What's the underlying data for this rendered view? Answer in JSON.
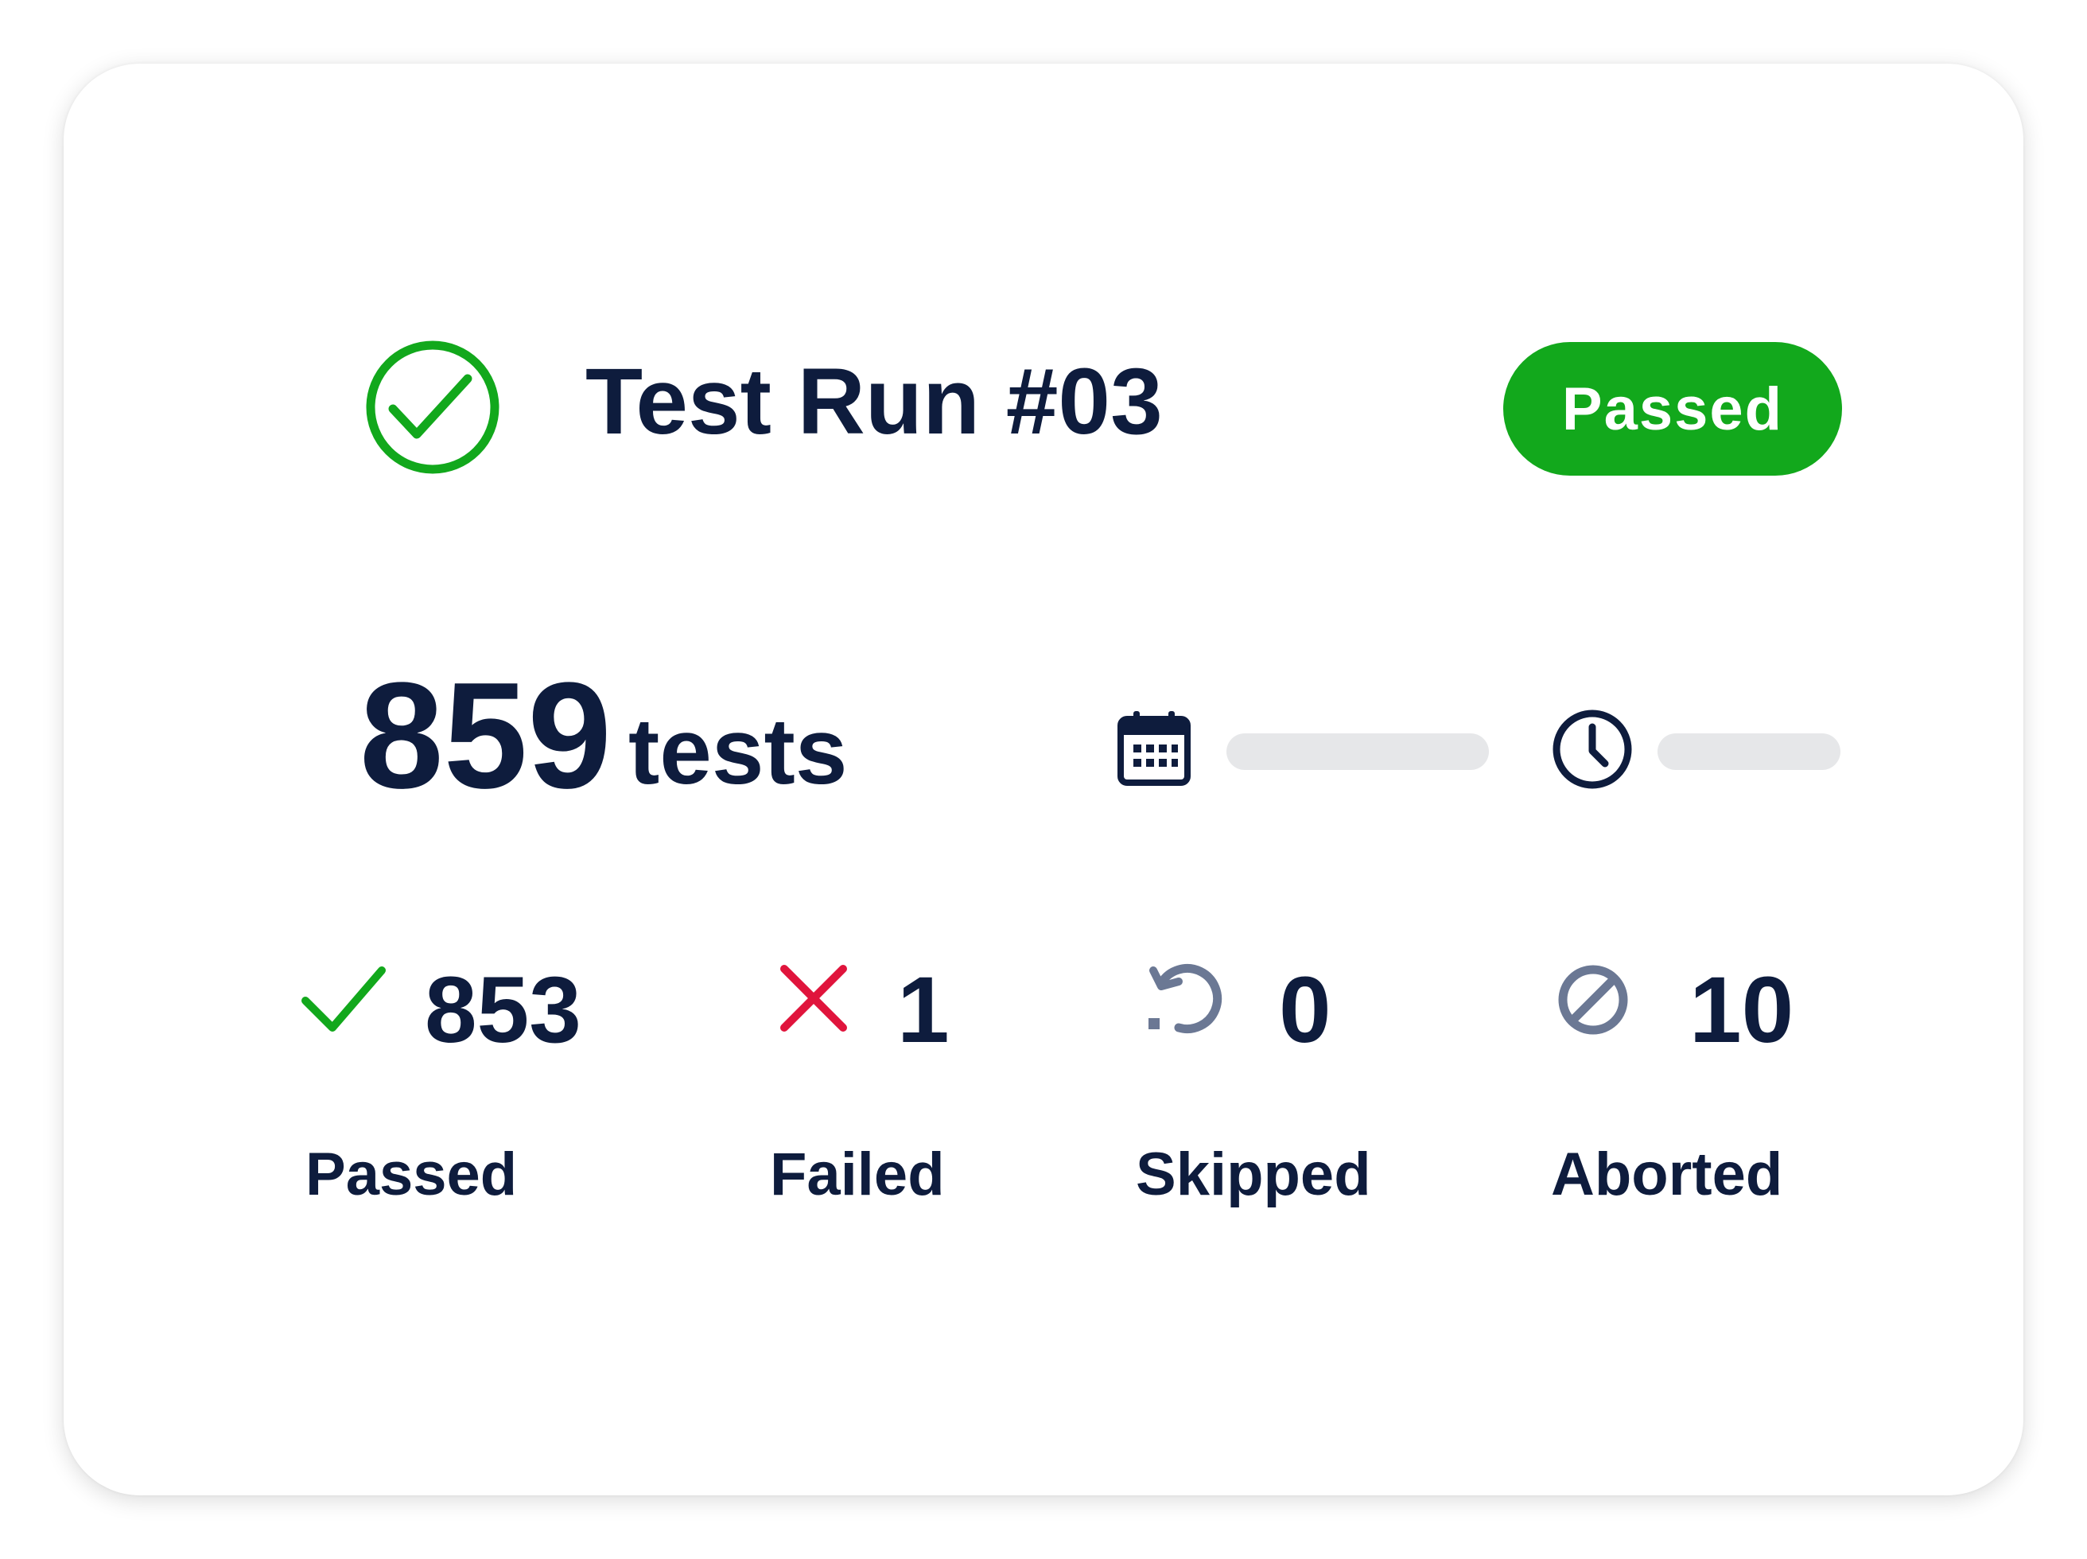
{
  "run": {
    "title": "Test Run #03",
    "status_label": "Passed",
    "status_color": "#12a81c"
  },
  "summary": {
    "total": "859",
    "unit": "tests",
    "date_icon": "calendar-icon",
    "duration_icon": "clock-icon"
  },
  "stats": [
    {
      "value": "853",
      "label": "Passed",
      "icon": "check-icon",
      "color": "#12a81c"
    },
    {
      "value": "1",
      "label": "Failed",
      "icon": "x-icon",
      "color": "#e0143c"
    },
    {
      "value": "0",
      "label": "Skipped",
      "icon": "skip-icon",
      "color": "#6b7894"
    },
    {
      "value": "10",
      "label": "Aborted",
      "icon": "aborted-icon",
      "color": "#6b7894"
    }
  ],
  "colors": {
    "text": "#0e1c3d",
    "placeholder": "#e6e7e9"
  }
}
